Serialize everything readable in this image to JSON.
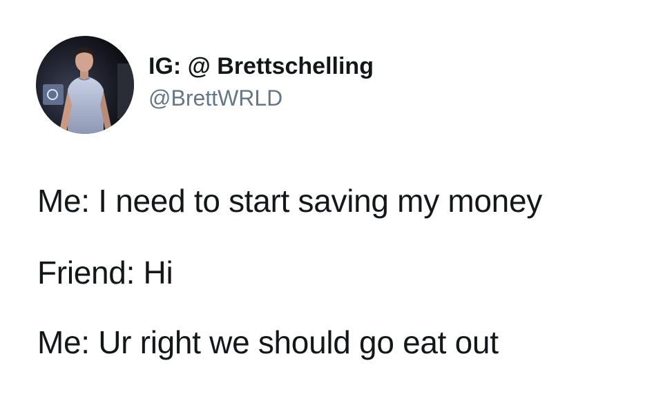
{
  "tweet": {
    "author": {
      "display_name": "IG: @ Brettschelling",
      "handle": "@BrettWRLD",
      "avatar_icon": "profile-photo"
    },
    "lines": [
      "Me: I need to start saving my money",
      "Friend: Hi",
      "Me: Ur right we should go eat out"
    ]
  }
}
